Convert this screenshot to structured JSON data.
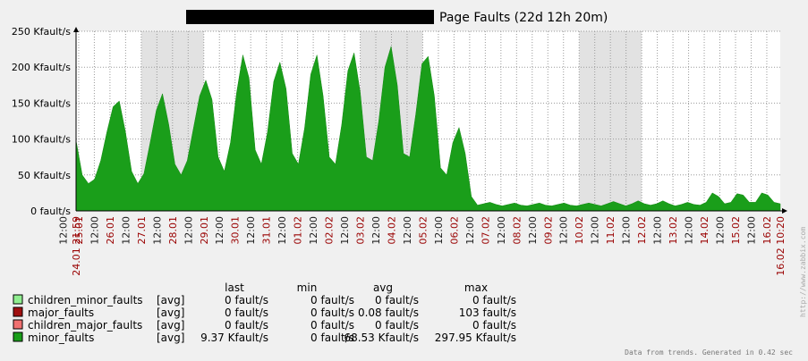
{
  "chart_data": {
    "type": "area",
    "title": "Page Faults  (22d 12h 20m)",
    "y_ticks": [
      "0 fault/s",
      "50 Kfault/s",
      "100 Kfault/s",
      "150 Kfault/s",
      "200 Kfault/s",
      "250 Kfault/s"
    ],
    "ylim": [
      0,
      250
    ],
    "y_unit": "Kfault/s",
    "grid": true,
    "start_label": "24.01 21:59",
    "end_label": "16.02 10:20",
    "x_date_labels": [
      "25.01",
      "26.01",
      "27.01",
      "28.01",
      "29.01",
      "30.01",
      "31.01",
      "01.02",
      "02.02",
      "03.02",
      "04.02",
      "05.02",
      "06.02",
      "07.02",
      "08.02",
      "09.02",
      "10.02",
      "11.02",
      "12.02",
      "13.02",
      "14.02",
      "15.02",
      "16.02"
    ],
    "x_noon_label": "12:00",
    "weekend_highlights": [
      [
        "27.01 00:00",
        "29.01 00:00"
      ],
      [
        "03.02 00:00",
        "05.02 00:00"
      ],
      [
        "10.02 00:00",
        "12.02 00:00"
      ]
    ],
    "series": [
      {
        "name": "minor_faults",
        "color": "#1a9e1a",
        "daily_peaks": [
          153,
          163,
          182,
          217,
          207,
          217,
          220,
          229,
          217,
          215,
          116,
          12,
          11,
          11,
          11,
          11,
          13,
          14,
          14,
          12,
          25,
          25,
          25
        ],
        "values_kfault_s": [
          98,
          50,
          38,
          44,
          70,
          110,
          145,
          153,
          110,
          55,
          38,
          52,
          95,
          140,
          163,
          120,
          65,
          50,
          70,
          115,
          160,
          182,
          155,
          75,
          55,
          95,
          165,
          217,
          185,
          85,
          65,
          110,
          180,
          207,
          170,
          80,
          65,
          115,
          190,
          217,
          160,
          75,
          65,
          120,
          195,
          220,
          165,
          75,
          70,
          125,
          200,
          229,
          175,
          80,
          75,
          135,
          205,
          215,
          160,
          60,
          50,
          95,
          116,
          80,
          20,
          8,
          10,
          12,
          9,
          7,
          9,
          11,
          8,
          7,
          9,
          11,
          8,
          7,
          9,
          11,
          8,
          7,
          9,
          11,
          9,
          7,
          10,
          13,
          10,
          7,
          10,
          14,
          10,
          8,
          10,
          14,
          10,
          7,
          9,
          12,
          9,
          8,
          12,
          25,
          20,
          10,
          12,
          24,
          22,
          12,
          12,
          25,
          22,
          12,
          10
        ]
      }
    ]
  },
  "legend": {
    "headers": {
      "last": "last",
      "min": "min",
      "avg": "avg",
      "max": "max"
    },
    "rows": [
      {
        "color": "#90ee90",
        "name": "children_minor_faults",
        "func": "[avg]",
        "last": "0 fault/s",
        "min": "0 fault/s",
        "avg": "0 fault/s",
        "max": "0 fault/s"
      },
      {
        "color": "#a01010",
        "name": "major_faults",
        "func": "[avg]",
        "last": "0 fault/s",
        "min": "0 fault/s",
        "avg": "0.08 fault/s",
        "max": "103 fault/s"
      },
      {
        "color": "#f07070",
        "name": "children_major_faults",
        "func": "[avg]",
        "last": "0 fault/s",
        "min": "0 fault/s",
        "avg": "0 fault/s",
        "max": "0 fault/s"
      },
      {
        "color": "#1a9e1a",
        "name": "minor_faults",
        "func": "[avg]",
        "last": "9.37 Kfault/s",
        "min": "0 fault/s",
        "avg": "68.53 Kfault/s",
        "max": "297.95 Kfault/s"
      }
    ]
  },
  "footer": "Data from trends. Generated in 0.42 sec",
  "watermark": "http://www.zabbix.com",
  "colors": {
    "date_label": "#990000",
    "time_label": "#202020",
    "weekend": "#e2e2e2",
    "grid": "#9a9a9a",
    "redacted": "#000000"
  }
}
